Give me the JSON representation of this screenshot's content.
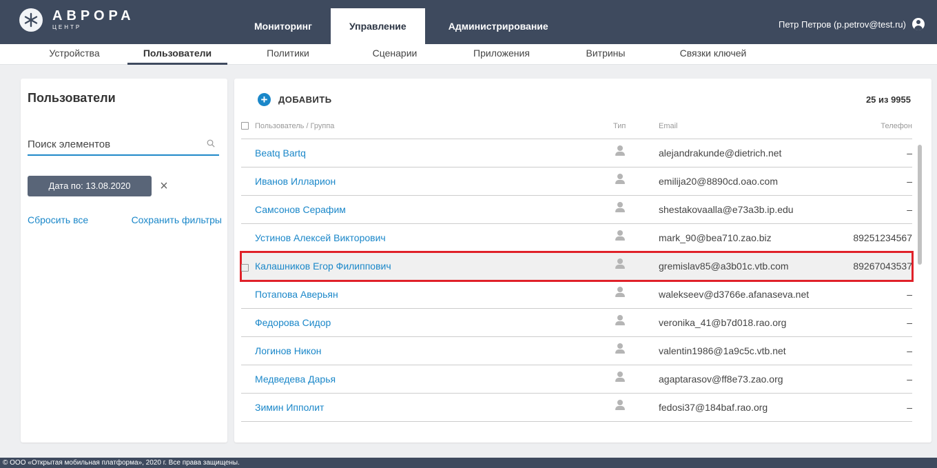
{
  "brand": {
    "name": "АВРОРА",
    "sub": "ЦЕНТР"
  },
  "main_nav": [
    {
      "label": "Мониторинг",
      "active": false
    },
    {
      "label": "Управление",
      "active": true
    },
    {
      "label": "Администрирование",
      "active": false
    }
  ],
  "user": {
    "label": "Петр Петров (p.petrov@test.ru)"
  },
  "sub_nav": [
    {
      "label": "Устройства"
    },
    {
      "label": "Пользователи"
    },
    {
      "label": "Политики"
    },
    {
      "label": "Сценарии"
    },
    {
      "label": "Приложения"
    },
    {
      "label": "Витрины"
    },
    {
      "label": "Связки ключей"
    }
  ],
  "sidebar": {
    "title": "Пользователи",
    "search_placeholder": "Поиск элементов",
    "filter_chip": "Дата по: 13.08.2020",
    "reset_label": "Сбросить все",
    "save_label": "Сохранить фильтры"
  },
  "toolbar": {
    "add_label": "ДОБАВИТЬ",
    "counter": "25 из 9955"
  },
  "table": {
    "columns": {
      "name": "Пользователь / Группа",
      "type": "Тип",
      "email": "Email",
      "phone": "Телефон"
    },
    "rows": [
      {
        "name": "Beatq Bartq",
        "email": "alejandrakunde@dietrich.net",
        "phone": "–"
      },
      {
        "name": "Иванов Илларион",
        "email": "emilija20@8890cd.oao.com",
        "phone": "–"
      },
      {
        "name": "Самсонов Серафим",
        "email": "shestakovaalla@e73a3b.ip.edu",
        "phone": "–"
      },
      {
        "name": "Устинов Алексей Викторович",
        "email": "mark_90@bea710.zao.biz",
        "phone": "89251234567"
      },
      {
        "name": "Калашников Егор Филиппович",
        "email": "gremislav85@a3b01c.vtb.com",
        "phone": "89267043537"
      },
      {
        "name": "Потапова Аверьян",
        "email": "walekseev@d3766e.afanaseva.net",
        "phone": "–"
      },
      {
        "name": "Федорова Сидор",
        "email": "veronika_41@b7d018.rao.org",
        "phone": "–"
      },
      {
        "name": "Логинов Никон",
        "email": "valentin1986@1a9c5c.vtb.net",
        "phone": "–"
      },
      {
        "name": "Медведева Дарья",
        "email": "agaptarasov@ff8e73.zao.org",
        "phone": "–"
      },
      {
        "name": "Зимин Ипполит",
        "email": "fedosi37@184baf.rao.org",
        "phone": "–"
      }
    ]
  },
  "footer": {
    "text": "© ООО «Открытая мобильная платформа», 2020 г. Все права защищены."
  },
  "colors": {
    "header": "#3e4a5e",
    "link": "#1a87c9",
    "highlight": "#e02129"
  }
}
